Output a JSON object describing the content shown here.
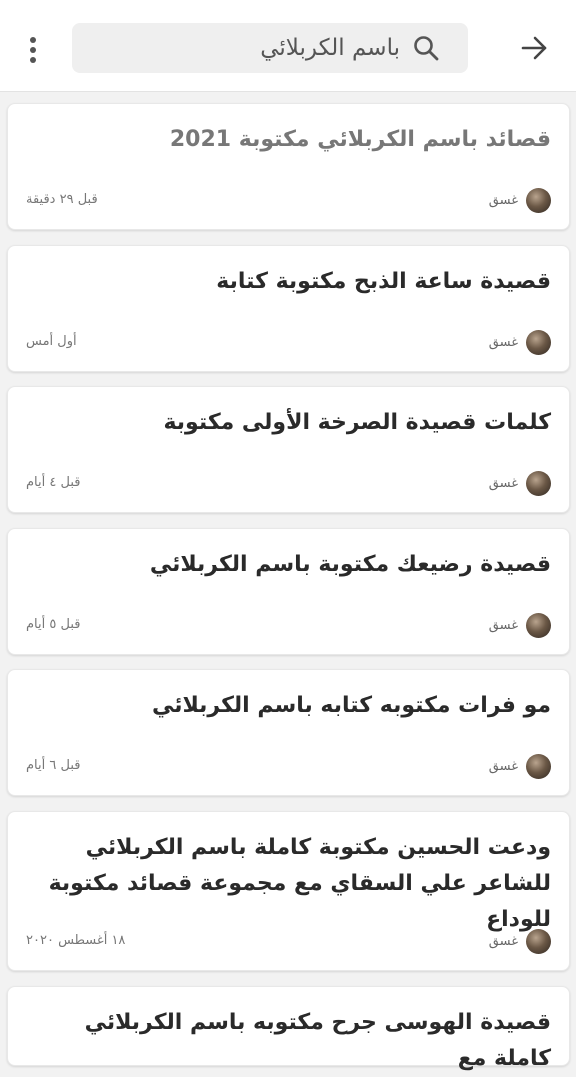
{
  "header": {
    "search_query": "باسم الكربلائي",
    "back_icon": "arrow-right-icon",
    "search_icon": "search-icon",
    "menu_icon": "more-vertical-icon"
  },
  "results": [
    {
      "title": "قصائد باسم الكربلائي مكتوبة 2021",
      "author": "غسق",
      "time": "قبل ٢٩ دقيقة"
    },
    {
      "title": "قصيدة ساعة الذبح مكتوبة كتابة",
      "author": "غسق",
      "time": "أول أمس"
    },
    {
      "title": "كلمات قصيدة الصرخة الأولى مكتوبة",
      "author": "غسق",
      "time": "قبل ٤ أيام"
    },
    {
      "title": "قصيدة رضيعك مكتوبة باسم الكربلائي",
      "author": "غسق",
      "time": "قبل ٥ أيام"
    },
    {
      "title": "مو فرات مكتوبه كتابه باسم الكربلائي",
      "author": "غسق",
      "time": "قبل ٦ أيام"
    },
    {
      "title": "ودعت الحسين مكتوبة كاملة باسم الكربلائي للشاعر علي السقاي مع مجموعة قصائد مكتوبة للوداع",
      "author": "غسق",
      "time": "١٨ أغسطس ٢٠٢٠"
    },
    {
      "title": "قصيدة الهوسى جرح مكتوبه باسم الكربلائي كاملة مع"
    }
  ]
}
